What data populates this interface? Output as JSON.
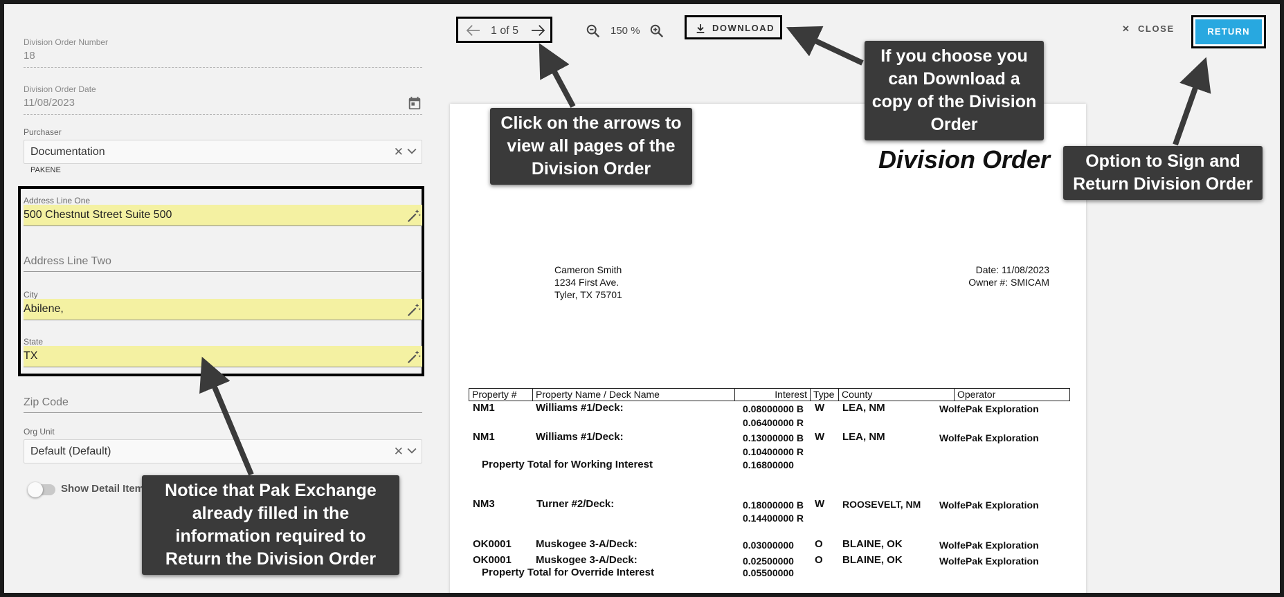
{
  "form": {
    "division_order_number": {
      "label": "Division Order Number",
      "value": "18"
    },
    "division_order_date": {
      "label": "Division Order Date",
      "value": "11/08/2023"
    },
    "purchaser": {
      "label": "Purchaser",
      "value": "Documentation",
      "sub": "PAKENE"
    },
    "address_line_one": {
      "label": "Address Line One",
      "value": "500 Chestnut Street Suite 500"
    },
    "address_line_two": {
      "placeholder": "Address Line Two"
    },
    "city": {
      "label": "City",
      "value": "Abilene,"
    },
    "state": {
      "label": "State",
      "value": "TX"
    },
    "zip_code": {
      "placeholder": "Zip Code"
    },
    "org_unit": {
      "label": "Org Unit",
      "value": "Default (Default)"
    },
    "show_detail": {
      "label": "Show Detail Items",
      "on": false
    }
  },
  "toolbar": {
    "pager": "1 of 5",
    "zoom": "150 %",
    "download": "DOWNLOAD",
    "close": "CLOSE",
    "return": "RETURN"
  },
  "document": {
    "title": "Division Order",
    "addressee": [
      "Cameron Smith",
      "1234 First Ave.",
      "Tyler, TX  75701"
    ],
    "date": "Date:  11/08/2023",
    "owner": "Owner #:  SMICAM",
    "headers": [
      "Property #",
      "Property Name / Deck Name",
      "Interest",
      "Type",
      "County",
      "Operator"
    ],
    "rows": [
      {
        "prop": "NM1",
        "name": "Williams #1/Deck:",
        "interest": [
          "0.08000000 B",
          "0.06400000 R"
        ],
        "type": "W",
        "county": "LEA, NM",
        "operator": "WolfePak Exploration"
      },
      {
        "prop": "NM1",
        "name": "Williams #1/Deck:",
        "interest": [
          "0.13000000 B",
          "0.10400000 R"
        ],
        "type": "W",
        "county": "LEA, NM",
        "operator": "WolfePak Exploration"
      },
      {
        "total_label": "Property  Total for Working Interest",
        "total": "0.16800000"
      },
      {
        "prop": "NM3",
        "name": "Turner #2/Deck:",
        "interest": [
          "0.18000000 B",
          "0.14400000 R"
        ],
        "type": "W",
        "county": "ROOSEVELT, NM",
        "operator": "WolfePak Exploration"
      },
      {
        "prop": "OK0001",
        "name": "Muskogee 3-A/Deck:",
        "interest": [
          "0.03000000"
        ],
        "type": "O",
        "county": "BLAINE, OK",
        "operator": "WolfePak Exploration"
      },
      {
        "prop": "OK0001",
        "name": "Muskogee 3-A/Deck:",
        "interest": [
          "0.02500000"
        ],
        "type": "O",
        "county": "BLAINE, OK",
        "operator": "WolfePak Exploration"
      },
      {
        "total_label": "Property  Total for Override Interest",
        "total": "0.05500000"
      }
    ]
  },
  "callouts": {
    "arrows": "Click on the arrows to view all pages of the Division Order",
    "download": "If you choose you can Download a copy of the Division Order",
    "sign": "Option to Sign and Return Division Order",
    "notice": "Notice that Pak Exchange already filled in the information required to Return the Division Order"
  }
}
